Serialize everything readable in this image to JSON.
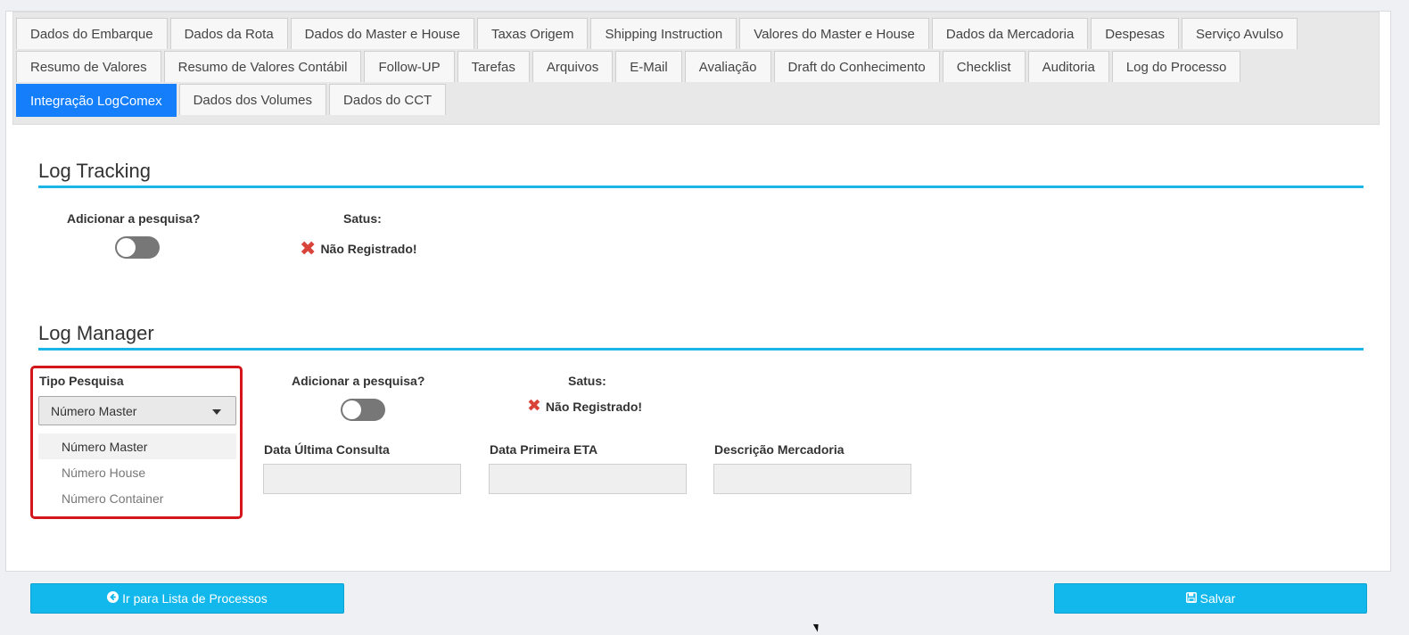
{
  "tabs": {
    "row1": [
      "Dados do Embarque",
      "Dados da Rota",
      "Dados do Master e House",
      "Taxas Origem",
      "Shipping Instruction",
      "Valores do Master e House",
      "Dados da Mercadoria",
      "Despesas",
      "Serviço Avulso"
    ],
    "row2": [
      "Resumo de Valores",
      "Resumo de Valores Contábil",
      "Follow-UP",
      "Tarefas",
      "Arquivos",
      "E-Mail",
      "Avaliação",
      "Draft do Conhecimento",
      "Checklist",
      "Auditoria",
      "Log do Processo"
    ],
    "row3": [
      "Integração LogComex",
      "Dados dos Volumes",
      "Dados do CCT"
    ],
    "active": "Integração LogComex"
  },
  "log_tracking": {
    "title": "Log Tracking",
    "add_label": "Adicionar a pesquisa?",
    "status_label": "Satus:",
    "status_value": "Não Registrado!"
  },
  "log_manager": {
    "title": "Log Manager",
    "search_type_label": "Tipo Pesquisa",
    "search_type_selected": "Número Master",
    "search_type_options": [
      "Número Master",
      "Número House",
      "Número Container"
    ],
    "add_label": "Adicionar a pesquisa?",
    "status_label": "Satus:",
    "status_value": "Não Registrado!",
    "last_query_label": "Data Última Consulta",
    "first_eta_label": "Data Primeira ETA",
    "goods_desc_label": "Descrição Mercadoria"
  },
  "buttons": {
    "back": "Ir para Lista de Processos",
    "save": "Salvar"
  },
  "icons": {
    "status": "close-icon",
    "back": "arrow-circle-left-icon",
    "save": "floppy-disk-icon"
  },
  "colors": {
    "active_tab": "#157efb",
    "accent_rule": "#1bb5e8",
    "button": "#12b8ec",
    "error": "#d9443a",
    "highlight": "#d4161c"
  }
}
